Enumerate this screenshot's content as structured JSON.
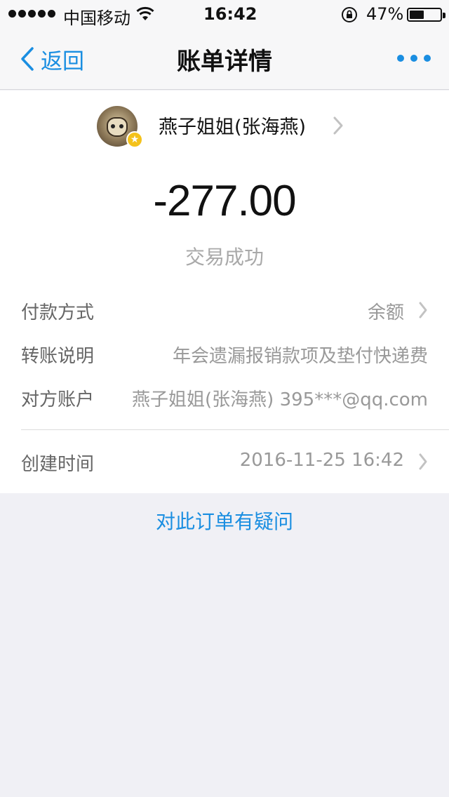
{
  "status_bar": {
    "carrier": "中国移动",
    "time": "16:42",
    "battery_percent": "47%",
    "battery_level": 0.47,
    "icons": [
      "signal-dots-icon",
      "wifi-icon",
      "rotation-lock-icon",
      "battery-icon"
    ]
  },
  "nav": {
    "back_label": "返回",
    "title": "账单详情",
    "more_icon": "more-dots-icon",
    "accent_color": "#1a8ee1"
  },
  "payee": {
    "name": "燕子姐姐(张海燕)",
    "badge_icon": "star-badge-icon"
  },
  "transaction": {
    "amount": "-277.00",
    "status": "交易成功"
  },
  "details": [
    {
      "label": "付款方式",
      "value": "余额"
    },
    {
      "label": "转账说明",
      "value": "年会遗漏报销款项及垫付快递费"
    },
    {
      "label": "对方账户",
      "value": "燕子姐姐(张海燕) 395***@qq.com"
    },
    {
      "label": "创建时间",
      "value": "2016-11-25 16:42"
    }
  ],
  "footer": {
    "question_link": "对此订单有疑问"
  }
}
